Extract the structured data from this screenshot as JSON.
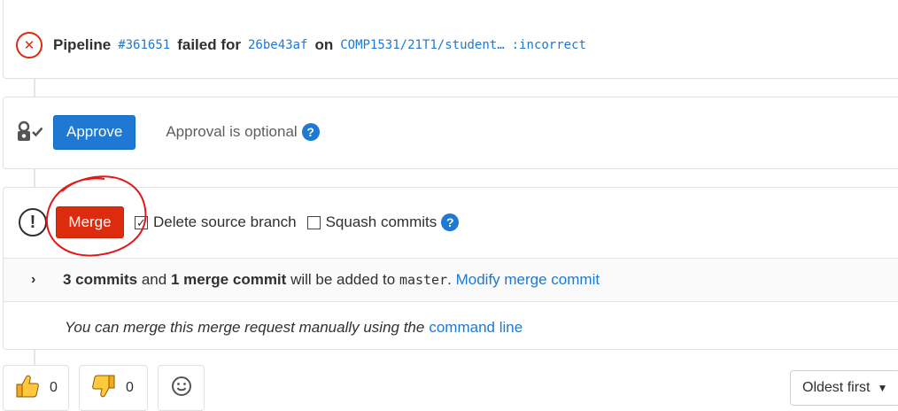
{
  "pipeline": {
    "label": "Pipeline",
    "id": "#361651",
    "failed_for": "failed for",
    "commit": "26be43af",
    "on": "on",
    "branch": "COMP1531/21T1/student…",
    "ref": ":incorrect"
  },
  "approval": {
    "button": "Approve",
    "status": "Approval is optional",
    "help": "?"
  },
  "merge": {
    "button": "Merge",
    "delete_branch_label": "Delete source branch",
    "delete_branch_checked": true,
    "squash_label": "Squash commits",
    "squash_checked": false,
    "help": "?"
  },
  "commits": {
    "commits_count": "3 commits",
    "and": "and",
    "merge_commit": "1 merge commit",
    "added_to": "will be added to",
    "target_branch": "master",
    "period": ".",
    "modify_link": "Modify merge commit"
  },
  "manual": {
    "text": "You can merge this merge request manually using the",
    "link": "command line"
  },
  "reactions": {
    "thumbsup_count": "0",
    "thumbsdown_count": "0"
  },
  "sort": {
    "label": "Oldest first"
  },
  "colors": {
    "primary": "#1f78d1",
    "danger": "#dd2b0e",
    "annotation": "#e21818"
  }
}
